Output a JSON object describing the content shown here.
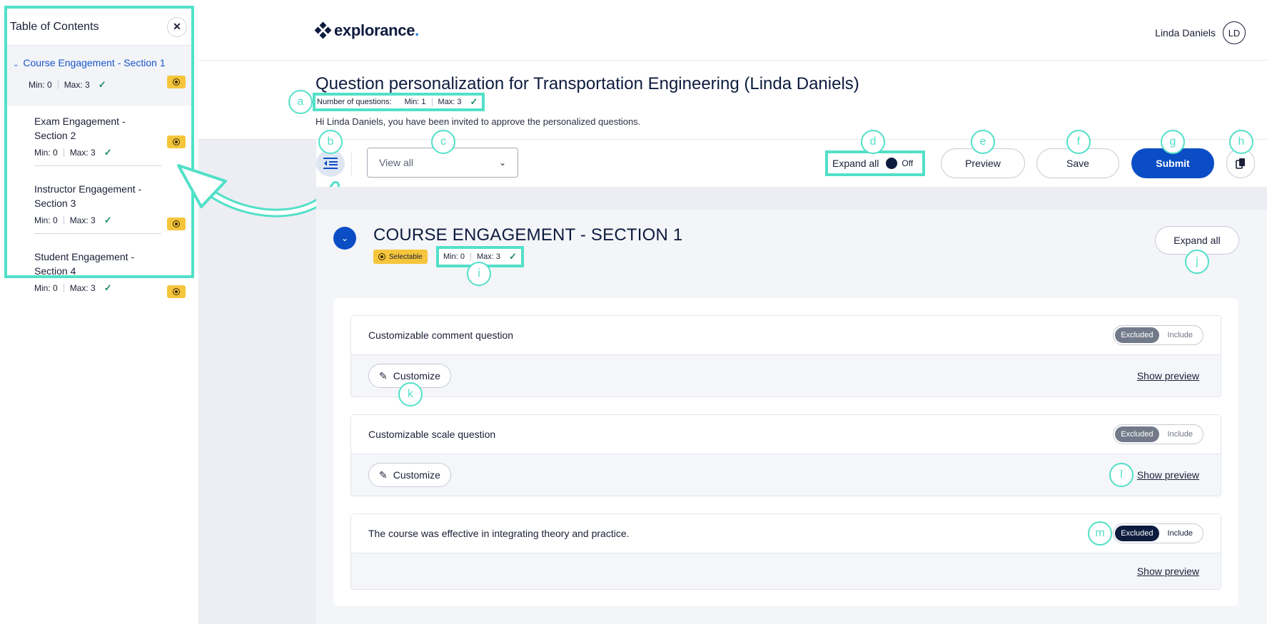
{
  "toc": {
    "title": "Table of Contents",
    "close_icon": "close-icon",
    "items": [
      {
        "label": "Course Engagement - Section 1",
        "min": "Min: 0",
        "max": "Max: 3",
        "active": true
      },
      {
        "label": "Exam Engagement - Section 2",
        "min": "Min: 0",
        "max": "Max: 3"
      },
      {
        "label": "Instructor Engagement - Section 3",
        "min": "Min: 0",
        "max": "Max: 3"
      },
      {
        "label": "Student Engagement - Section 4",
        "min": "Min: 0",
        "max": "Max: 3"
      }
    ]
  },
  "header": {
    "logo_text": "explorance",
    "logo_dot": ".",
    "user_name": "Linda Daniels",
    "user_initials": "LD"
  },
  "page": {
    "title": "Question personalization for Transportation Engineering (Linda Daniels)",
    "num_questions_label": "Number of questions:",
    "num_min": "Min: 1",
    "num_max": "Max: 3",
    "invite_text": "Hi Linda Daniels, you have been invited to approve the personalized questions."
  },
  "toolbar": {
    "view_select_value": "View all",
    "expand_all_label": "Expand all",
    "expand_all_state": "Off",
    "preview_label": "Preview",
    "save_label": "Save",
    "submit_label": "Submit"
  },
  "section": {
    "title": "COURSE ENGAGEMENT - SECTION 1",
    "badge": "Selectable",
    "min": "Min: 0",
    "max": "Max: 3",
    "expand_all_label": "Expand all"
  },
  "questions": [
    {
      "title": "Customizable comment question",
      "excluded": "Excluded",
      "include": "Include",
      "customize": "Customize",
      "preview": "Show preview"
    },
    {
      "title": "Customizable scale question",
      "excluded": "Excluded",
      "include": "Include",
      "customize": "Customize",
      "preview": "Show preview"
    },
    {
      "title": "The course was effective in integrating theory and practice.",
      "excluded": "Excluded",
      "include": "Include",
      "preview": "Show preview"
    }
  ],
  "callouts": {
    "a": "a",
    "b": "b",
    "c": "c",
    "d": "d",
    "e": "e",
    "f": "f",
    "g": "g",
    "h": "h",
    "i": "i",
    "j": "j",
    "k": "k",
    "l": "l",
    "m": "m"
  },
  "colors": {
    "accent": "#0b4dc4",
    "annotation": "#52e0c8",
    "badge": "#f5c53c"
  }
}
